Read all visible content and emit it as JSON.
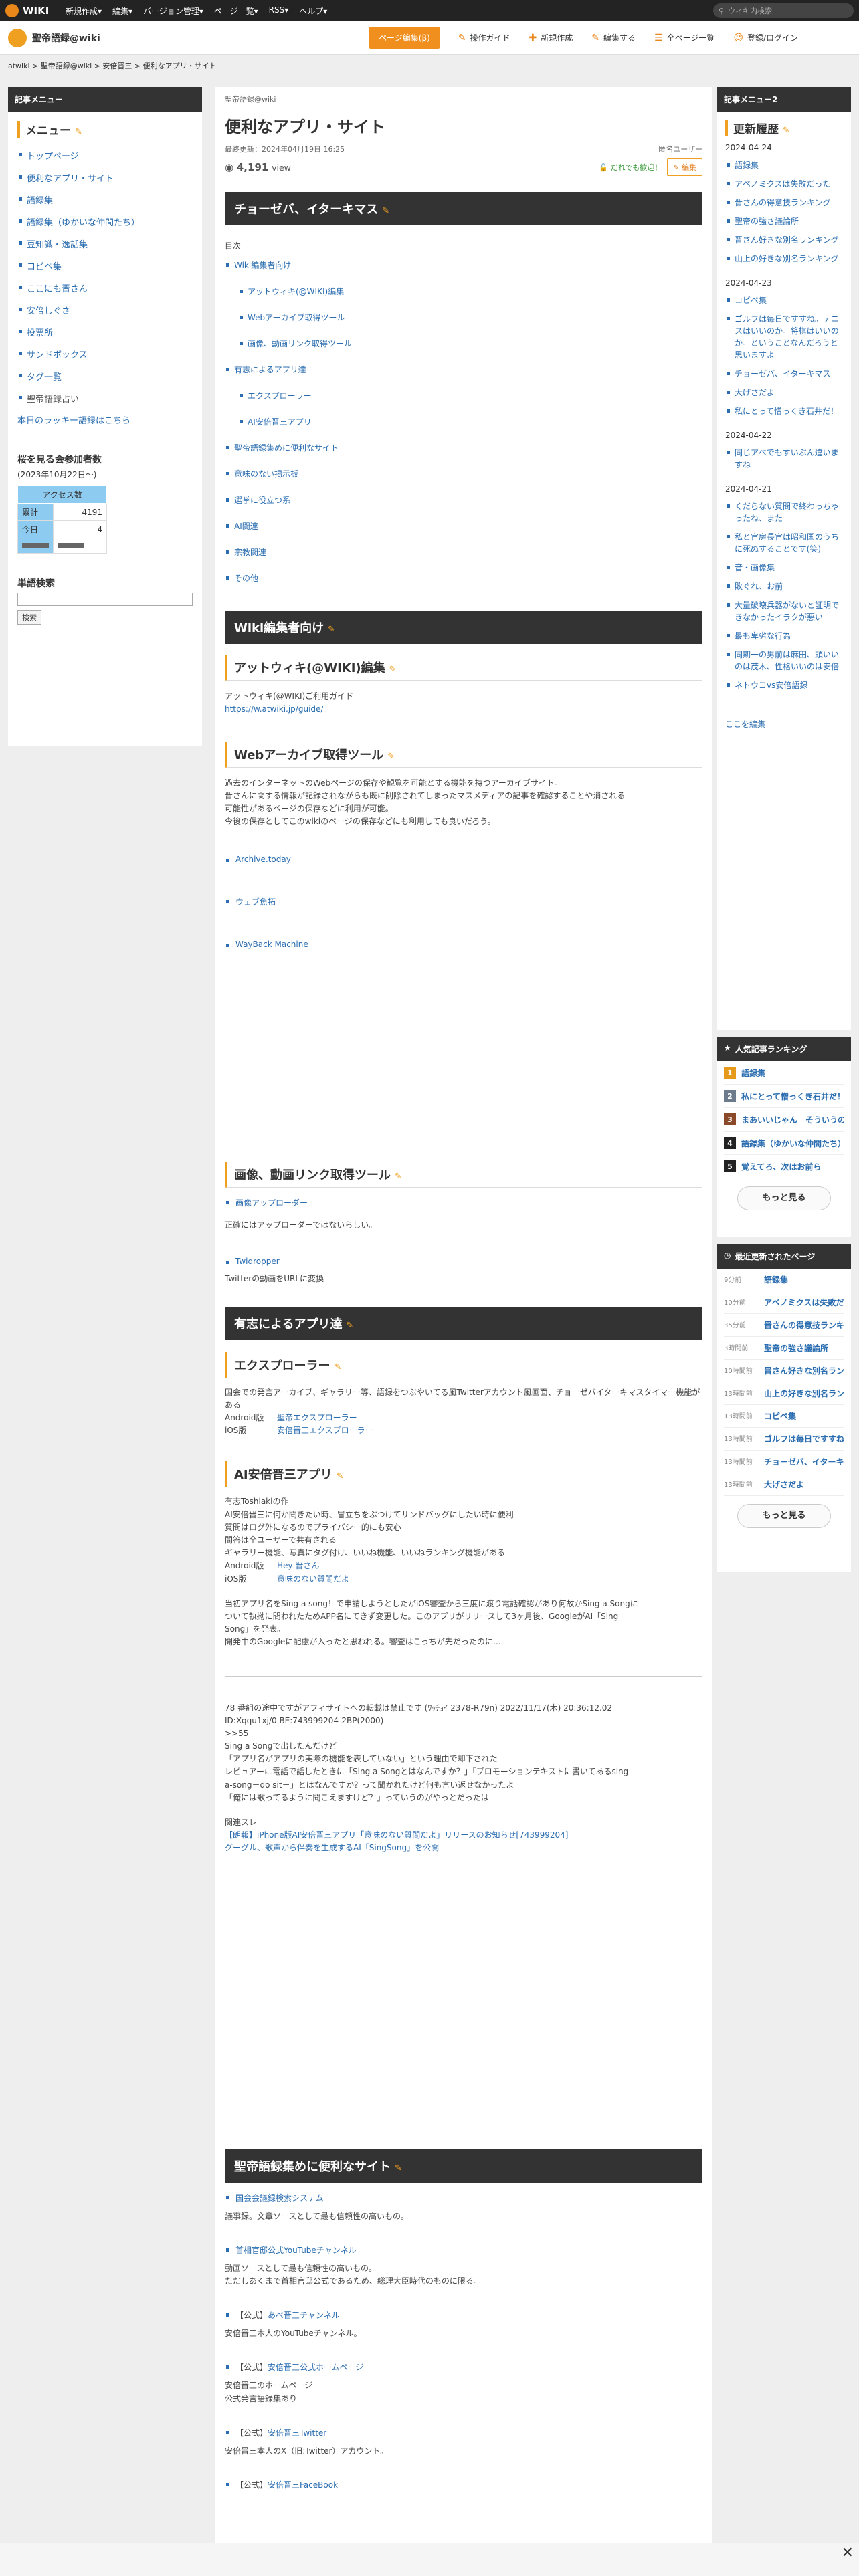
{
  "topbar": {
    "logo": "WIKI",
    "nav": [
      "新規作成▾",
      "編集▾",
      "バージョン管理▾",
      "ページ一覧▾",
      "RSS▾",
      "ヘルプ▾"
    ],
    "search_placeholder": "ウィキ内検索"
  },
  "sitebar": {
    "name": "聖帝語録@wiki",
    "edit_button": "ページ編集(β)",
    "tools": [
      {
        "icon": "✎",
        "label": "操作ガイド"
      },
      {
        "icon": "✚",
        "label": "新規作成"
      },
      {
        "icon": "✎",
        "label": "編集する"
      },
      {
        "icon": "☰",
        "label": "全ページ一覧"
      },
      {
        "icon": "☺",
        "label": "登録/ログイン"
      }
    ]
  },
  "breadcrumb": "atwiki > 聖帝語録@wiki > 安倍晋三 > 便利なアプリ・サイト",
  "left": {
    "header": "記事メニュー",
    "menu_title": "メニュー",
    "items": [
      "トップページ",
      "便利なアプリ・サイト",
      "語録集",
      "語録集（ゆかいな仲間たち）",
      "豆知識・逸話集",
      "コピペ集",
      "ここにも晋さん",
      "安倍しぐさ",
      "投票所",
      "サンドボックス",
      "タグ一覧",
      "聖帝語録占い"
    ],
    "lucky": "本日のラッキー語録はこちら",
    "counter_title": "桜を見る会参加者数",
    "counter_sub": "(2023年10月22日〜)",
    "counter_head": "アクセス数",
    "counter_rows": [
      {
        "label": "累計",
        "value": "4191"
      },
      {
        "label": "今日",
        "value": "4"
      }
    ],
    "word_search": "単語検索",
    "search_btn": "検索"
  },
  "main": {
    "site_small": "聖帝語録@wiki",
    "title": "便利なアプリ・サイト",
    "updated": "最終更新：2024年04月19日 16:25",
    "user": "匿名ユーザー",
    "views": "4,191",
    "views_suffix": "view",
    "anyone": "だれでも歓迎！",
    "edit": "編集",
    "h_chosen": "チョーゼバ、イターキマス",
    "toc_label": "目次",
    "toc": [
      {
        "t": "Wiki編集者向け",
        "l": 0
      },
      {
        "t": "アットウィキ(@WIKI)編集",
        "l": 1
      },
      {
        "t": "Webアーカイブ取得ツール",
        "l": 1
      },
      {
        "t": "画像、動画リンク取得ツール",
        "l": 1
      },
      {
        "t": "有志によるアプリ達",
        "l": 0
      },
      {
        "t": "エクスプローラー",
        "l": 1
      },
      {
        "t": "AI安倍晋三アプリ",
        "l": 1
      },
      {
        "t": "聖帝語録集めに便利なサイト",
        "l": 0
      },
      {
        "t": "意味のない掲示板",
        "l": 0
      },
      {
        "t": "選挙に役立つ系",
        "l": 0
      },
      {
        "t": "AI関連",
        "l": 0
      },
      {
        "t": "宗教関連",
        "l": 0
      },
      {
        "t": "その他",
        "l": 0
      }
    ],
    "h_wiki": "Wiki編集者向け",
    "h_atwiki": "アットウィキ(@WIKI)編集",
    "atwiki_text": "アットウィキ(@WIKI)ご利用ガイド",
    "atwiki_link": "https://w.atwiki.jp/guide/",
    "h_archive": "Webアーカイブ取得ツール",
    "archive_text": [
      "過去のインターネットのWebページの保存や観覧を可能とする機能を持つアーカイブサイト。",
      "晋さんに関する情報が記録されながらも既に削除されてしまったマスメディアの記事を確認することや消される",
      "可能性があるページの保存などに利用が可能。",
      "今後の保存としてこのwikiのページの保存などにも利用しても良いだろう。"
    ],
    "archive_links": [
      "Archive.today",
      "ウェブ魚拓",
      "WayBack Machine"
    ],
    "h_image": "画像、動画リンク取得ツール",
    "image_link1": "画像アップローダー",
    "image_text1": "正確にはアップローダーではないらしい。",
    "image_link2": "Twidropper",
    "image_text2": "Twitterの動画をURLに変換",
    "h_apps": "有志によるアプリ達",
    "h_explorer": "エクスプローラー",
    "explorer_text": "国会での発言アーカイブ、ギャラリー等、語録をつぶやいてる風Twitterアカウント風画面、チョーゼバイターキマスタイマー機能がある",
    "explorer_android_label": "Android版",
    "explorer_android": "聖帝エクスプローラー",
    "explorer_ios_label": "iOS版",
    "explorer_ios": "安倍晋三エクスプローラー",
    "h_ai": "AI安倍晋三アプリ",
    "ai_text": [
      "有志Toshiakiの作",
      "AI安倍晋三に何か聞きたい時、冒立ちをぶつけてサンドバッグにしたい時に便利",
      "質問はログ外になるのでプライバシー的にも安心",
      "問答は全ユーザーで共有される",
      "ギャラリー機能、写真にタグ付け、いいね機能、いいねランキング機能がある"
    ],
    "ai_android_label": "Android版",
    "ai_android": "Hey 晋さん",
    "ai_ios_label": "iOS版",
    "ai_ios": "意味のない質問だよ",
    "ai_story": [
      "当初アプリ名をSing a song！で申請しようとしたがiOS審査から三度に渡り電話確認があり何故かSing a Songに",
      "ついて執拗に問われたためAPP名にてきず変更した。このアプリがリリースして3ヶ月後、GoogleがAI「Sing",
      "Song」を発表。",
      "開発中のGoogleに配慮が入ったと思われる。審査はこっちが先だったのに…"
    ],
    "quote": [
      "78 番組の途中ですがアフィサイトへの転載は禁止です (ﾜｯﾁｮｲ 2378-R79n) 2022/11/17(木) 20:36:12.02",
      "ID:Xqqu1xj/0 BE:743999204-2BP(2000)",
      ">>55",
      "Sing a Songで出したんだけど",
      "「アプリ名がアプリの実際の機能を表していない」という理由で却下された",
      "レビュアーに電話で話したときに「Sing a Songとはなんですか？」「プロモーションテキストに書いてあるsing-",
      "a-song－do sit－」とはなんですか？って聞かれたけど何も言い返せなかったよ",
      "「俺には歌ってるように聞こえますけど？」っていうのがやっとだったは"
    ],
    "related_label": "関連スレ",
    "related": [
      "【朗報】iPhone版AI安倍晋三アプリ「意味のない質問だよ」リリースのお知らせ[743999204]",
      "グーグル、歌声から伴奏を生成するAI「SingSong」を公開"
    ],
    "h_sites": "聖帝語録集めに便利なサイト",
    "sites": [
      {
        "prefix": "",
        "link": "国会会議録検索システム",
        "desc": [
          "議事録。文章ソースとして最も信頼性の高いもの。"
        ]
      },
      {
        "prefix": "",
        "link": "首相官邸公式YouTubeチャンネル",
        "desc": [
          "動画ソースとして最も信頼性の高いもの。",
          "ただしあくまで首相官邸公式であるため、総理大臣時代のものに限る。"
        ]
      },
      {
        "prefix": "【公式】",
        "link": "あべ晋三チャンネル",
        "desc": [
          "安倍晋三本人のYouTubeチャンネル。"
        ]
      },
      {
        "prefix": "【公式】",
        "link": "安倍晋三公式ホームページ",
        "desc": [
          "安倍晋三のホームページ",
          "公式発言語録集あり"
        ]
      },
      {
        "prefix": "【公式】",
        "link": "安倍晋三Twitter",
        "desc": [
          "安倍晋三本人のX（旧:Twitter）アカウント。"
        ]
      },
      {
        "prefix": "【公式】",
        "link": "安倍晋三FaceBook",
        "desc": []
      }
    ]
  },
  "right": {
    "header": "記事メニュー2",
    "recent_title": "更新履歴",
    "groups": [
      {
        "date": "2024-04-24",
        "items": [
          "語録集",
          "アベノミクスは失敗だった",
          "晋さんの得意技ランキング",
          "聖帝の強さ議論所",
          "晋さん好きな別名ランキング",
          "山上の好きな別名ランキング"
        ]
      },
      {
        "date": "2024-04-23",
        "items": [
          "コピペ集",
          "ゴルフは毎日ですすね。テニスはいいのか。将棋はいいのか。ということなんだろうと思いますよ",
          "チョーゼバ、イターキマス",
          "大げさだよ",
          "私にとって憎っくき石井だ！"
        ]
      },
      {
        "date": "2024-04-22",
        "items": [
          "同じアベでもすいぶん違いますね"
        ]
      },
      {
        "date": "2024-04-21",
        "items": [
          "くだらない質問で終わっちゃったね、また",
          "私と官房長官は昭和国のうちに死ぬすることです(笑)",
          "音・画像集",
          "敗ぐれ、お前",
          "大量破壊兵器がないと証明できなかったイラクが悪い",
          "最も卑劣な行為",
          "同期一の男前は麻田、頭いいのは茂木、性格いいのは安倍",
          "ネトウヨvs安倍語録"
        ]
      }
    ],
    "edit_here": "ここを編集",
    "ranking_title": "人気記事ランキング",
    "ranking": [
      {
        "n": "1",
        "t": "語録集",
        "c": "#e69a1c"
      },
      {
        "n": "2",
        "t": "私にとって憎っくき石井だ！",
        "c": "#6b7b8c"
      },
      {
        "n": "3",
        "t": "まあいいじゃん　そういうの",
        "c": "#8a4a2a"
      },
      {
        "n": "4",
        "t": "語録集（ゆかいな仲間たち）",
        "c": "#222222"
      },
      {
        "n": "5",
        "t": "覚えてろ、次はお前ら",
        "c": "#222222"
      }
    ],
    "more": "もっと見る",
    "updated_title": "最近更新されたページ",
    "updates": [
      {
        "t": "9分前",
        "p": "語録集"
      },
      {
        "t": "10分前",
        "p": "アベノミクスは失敗だった"
      },
      {
        "t": "35分前",
        "p": "晋さんの得意技ランキング"
      },
      {
        "t": "3時間前",
        "p": "聖帝の強さ議論所"
      },
      {
        "t": "10時間前",
        "p": "晋さん好きな別名ランキング"
      },
      {
        "t": "13時間前",
        "p": "山上の好きな別名ランキング"
      },
      {
        "t": "13時間前",
        "p": "コピペ集"
      },
      {
        "t": "13時間前",
        "p": "ゴルフは毎日ですすね"
      },
      {
        "t": "13時間前",
        "p": "チョーゼバ、イターキマス"
      },
      {
        "t": "13時間前",
        "p": "大げさだよ"
      }
    ]
  },
  "bottom": {
    "close": "✕"
  }
}
